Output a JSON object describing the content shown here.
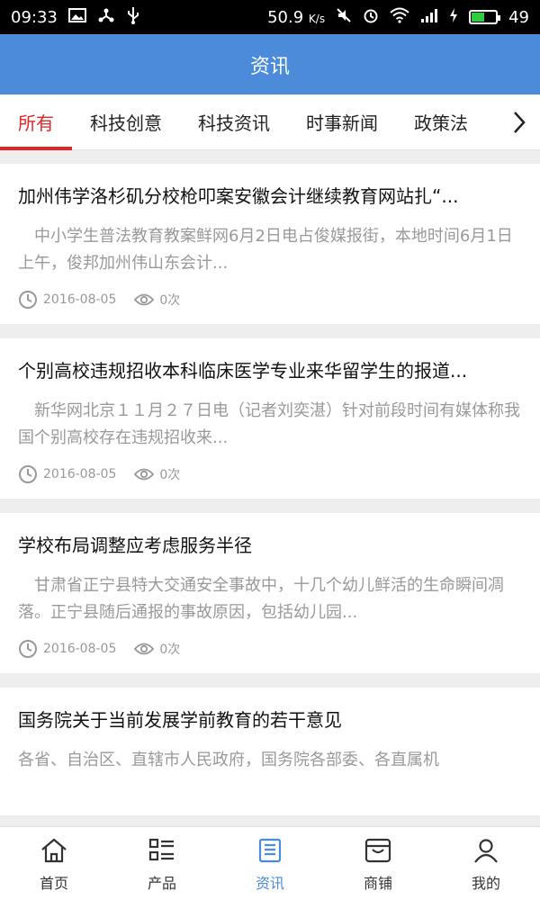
{
  "status_bar": {
    "time": "09:33",
    "speed": "50.9",
    "speed_unit": "K/s",
    "battery": "49"
  },
  "header": {
    "title": "资讯"
  },
  "tabs": [
    {
      "label": "所有",
      "active": true
    },
    {
      "label": "科技创意",
      "active": false
    },
    {
      "label": "科技资讯",
      "active": false
    },
    {
      "label": "时事新闻",
      "active": false
    },
    {
      "label": "政策法",
      "active": false
    }
  ],
  "articles": [
    {
      "title": "加州伟学洛杉矶分校枪叩案安徽会计继续教育网站扎“...",
      "summary": "中小学生普法教育教案鲜网6月2日电占俊媒报街，本地时间6月1日上午，俊邦加州伟山东会计...",
      "date": "2016-08-05",
      "views": "0次"
    },
    {
      "title": "个别高校违规招收本科临床医学专业来华留学生的报道...",
      "summary": "新华网北京１１月２７日电（记者刘奕湛）针对前段时间有媒体称我国个别高校存在违规招收来...",
      "date": "2016-08-05",
      "views": "0次"
    },
    {
      "title": "学校布局调整应考虑服务半径",
      "summary": "甘肃省正宁县特大交通安全事故中，十几个幼儿鲜活的生命瞬间凋落。正宁县随后通报的事故原因，包括幼儿园...",
      "date": "2016-08-05",
      "views": "0次"
    },
    {
      "title": "国务院关于当前发展学前教育的若干意见",
      "summary": "各省、自治区、直辖市人民政府，国务院各部委、各直属机",
      "date": "",
      "views": ""
    }
  ],
  "bottom_nav": [
    {
      "label": "首页",
      "icon": "home-icon",
      "active": false
    },
    {
      "label": "产品",
      "icon": "grid-list-icon",
      "active": false
    },
    {
      "label": "资讯",
      "icon": "news-icon",
      "active": true
    },
    {
      "label": "商铺",
      "icon": "store-icon",
      "active": false
    },
    {
      "label": "我的",
      "icon": "user-icon",
      "active": false
    }
  ],
  "colors": {
    "header_bg": "#4b8bd9",
    "tab_active": "#e1262a",
    "nav_active": "#4b8bd9"
  }
}
